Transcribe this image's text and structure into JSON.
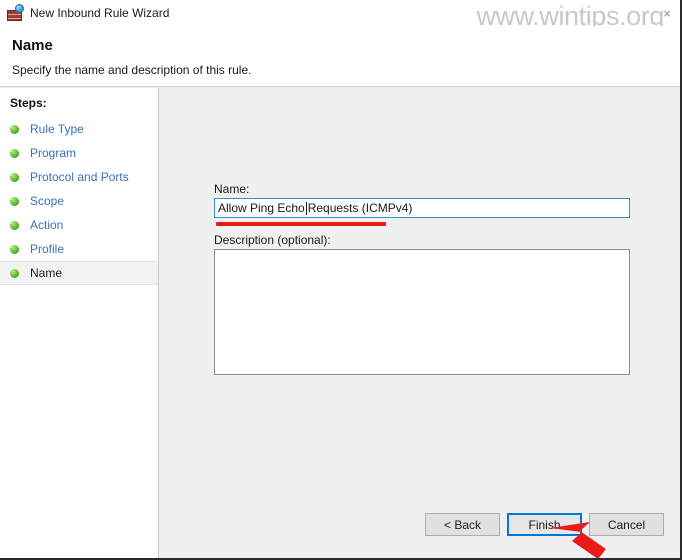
{
  "window": {
    "title": "New Inbound Rule Wizard",
    "icon": "firewall-icon",
    "close_label": "×"
  },
  "watermark": {
    "text": "www.wintips.org"
  },
  "header": {
    "title": "Name",
    "subtitle": "Specify the name and description of this rule."
  },
  "sidebar": {
    "title": "Steps:",
    "items": [
      {
        "label": "Rule Type",
        "state": "done"
      },
      {
        "label": "Program",
        "state": "done"
      },
      {
        "label": "Protocol and Ports",
        "state": "done"
      },
      {
        "label": "Scope",
        "state": "done"
      },
      {
        "label": "Action",
        "state": "done"
      },
      {
        "label": "Profile",
        "state": "done"
      },
      {
        "label": "Name",
        "state": "current"
      }
    ]
  },
  "form": {
    "name_label": "Name:",
    "name_value_before_caret": "Allow Ping Echo",
    "name_value_after_caret": "Requests (ICMPv4)",
    "name_value": "Allow Ping Echo Requests (ICMPv4)",
    "description_label": "Description (optional):",
    "description_value": ""
  },
  "buttons": {
    "back": "< Back",
    "finish": "Finish",
    "cancel": "Cancel"
  },
  "annotations": {
    "underline_color": "#e81b18",
    "arrow_color": "#e81b18"
  },
  "colors": {
    "accent": "#0078d7",
    "link": "#3d6fb5",
    "step_done": "#56bd28",
    "content_bg": "#f0f0f0"
  }
}
